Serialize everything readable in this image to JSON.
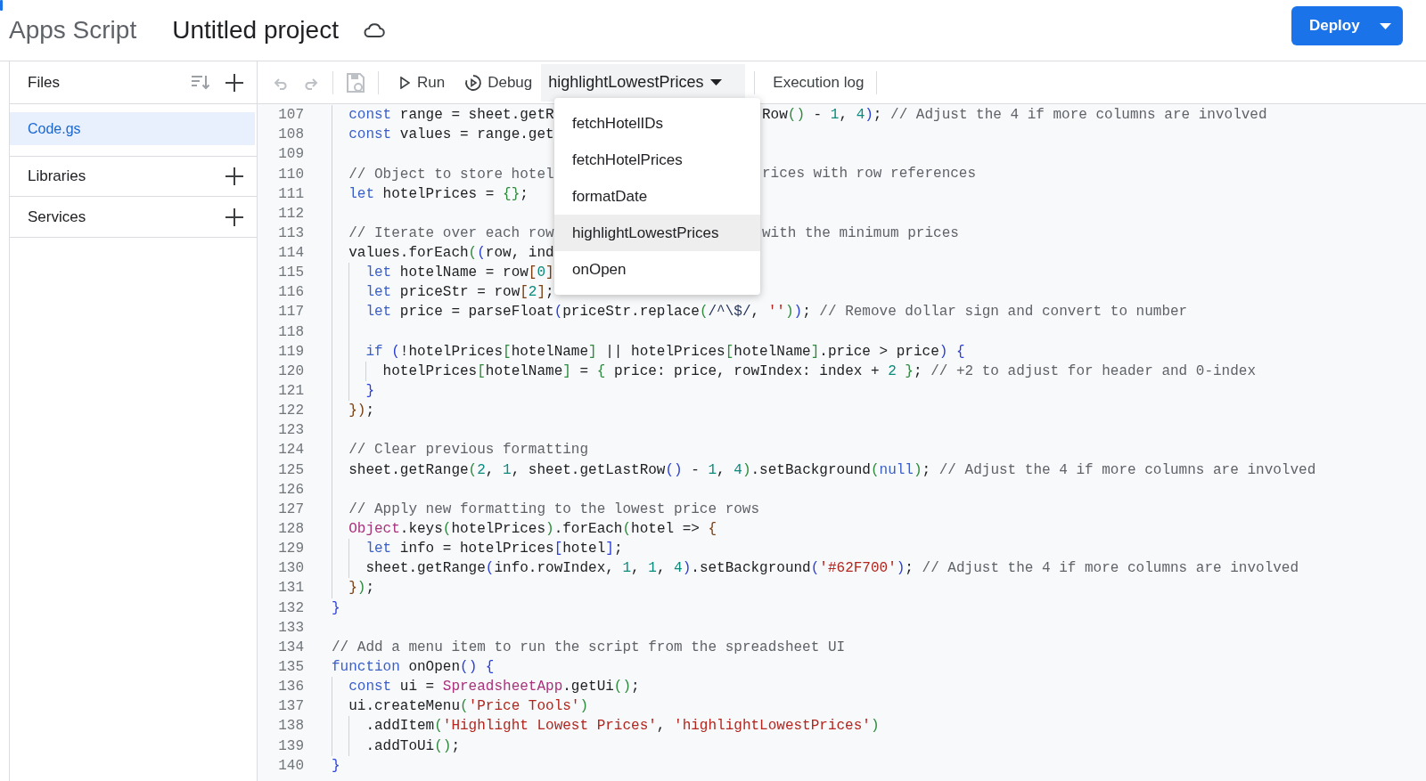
{
  "app": {
    "name": "Apps Script",
    "project_title": "Untitled project",
    "deploy_label": "Deploy"
  },
  "sidebar": {
    "files_label": "Files",
    "files": [
      {
        "name": "Code.gs",
        "selected": true
      }
    ],
    "sections": [
      {
        "label": "Libraries"
      },
      {
        "label": "Services"
      }
    ]
  },
  "toolbar": {
    "run_label": "Run",
    "debug_label": "Debug",
    "function_label": "highlightLowestPrices",
    "execution_log_label": "Execution log"
  },
  "function_menu": {
    "items": [
      {
        "label": "fetchHotelIDs",
        "selected": false
      },
      {
        "label": "fetchHotelPrices",
        "selected": false
      },
      {
        "label": "formatDate",
        "selected": false
      },
      {
        "label": "highlightLowestPrices",
        "selected": true
      },
      {
        "label": "onOpen",
        "selected": false
      }
    ]
  },
  "editor": {
    "lines": [
      {
        "number": "107",
        "parts": [
          {
            "kind": "kw",
            "text": "  const"
          },
          {
            "kind": "p",
            "text": " range = sheet.getR"
          }
        ],
        "after_menu": [
          {
            "kind": "p",
            "text": "Row"
          },
          {
            "kind": "b2",
            "text": "()"
          },
          {
            "kind": "p",
            "text": " - "
          },
          {
            "kind": "num",
            "text": "1"
          },
          {
            "kind": "p",
            "text": ", "
          },
          {
            "kind": "num",
            "text": "4"
          },
          {
            "kind": "b1",
            "text": ")"
          },
          {
            "kind": "p",
            "text": "; "
          },
          {
            "kind": "cm",
            "text": "// Adjust the 4 if more columns are involved"
          }
        ]
      },
      {
        "number": "108",
        "parts": [
          {
            "kind": "kw",
            "text": "  const"
          },
          {
            "kind": "p",
            "text": " values = range.get"
          }
        ]
      },
      {
        "number": "109"
      },
      {
        "number": "110",
        "parts": [
          {
            "kind": "cm",
            "text": "  // Object to store hotel"
          }
        ],
        "after_menu": [
          {
            "kind": "cm",
            "text": "rices with row references"
          }
        ]
      },
      {
        "number": "111",
        "parts": [
          {
            "kind": "kw",
            "text": "  let"
          },
          {
            "kind": "p",
            "text": " hotelPrices = "
          },
          {
            "kind": "b2",
            "text": "{}"
          },
          {
            "kind": "p",
            "text": ";"
          }
        ]
      },
      {
        "number": "112"
      },
      {
        "number": "113",
        "parts": [
          {
            "kind": "cm",
            "text": "  // Iterate over each row"
          }
        ],
        "after_menu": [
          {
            "kind": "cm",
            "text": "with the minimum prices"
          }
        ]
      },
      {
        "number": "114",
        "parts": [
          {
            "kind": "p",
            "text": "  values.forEach"
          },
          {
            "kind": "b2",
            "text": "("
          },
          {
            "kind": "b1",
            "text": "("
          },
          {
            "kind": "p",
            "text": "row, ind"
          }
        ]
      },
      {
        "number": "115",
        "parts": [
          {
            "kind": "kw",
            "text": "    let"
          },
          {
            "kind": "p",
            "text": " hotelName = row"
          },
          {
            "kind": "b3",
            "text": "["
          },
          {
            "kind": "num",
            "text": "0"
          },
          {
            "kind": "b3",
            "text": "]"
          }
        ]
      },
      {
        "number": "116",
        "parts": [
          {
            "kind": "kw",
            "text": "    let"
          },
          {
            "kind": "p",
            "text": " priceStr = row"
          },
          {
            "kind": "b3",
            "text": "["
          },
          {
            "kind": "num",
            "text": "2"
          },
          {
            "kind": "b3",
            "text": "]"
          },
          {
            "kind": "p",
            "text": ";"
          }
        ]
      },
      {
        "number": "117",
        "parts": [
          {
            "kind": "kw",
            "text": "    let"
          },
          {
            "kind": "p",
            "text": " price = parseFloat"
          },
          {
            "kind": "b1",
            "text": "("
          },
          {
            "kind": "p",
            "text": "priceStr.replace"
          },
          {
            "kind": "b2",
            "text": "("
          },
          {
            "kind": "re",
            "text": "/^\\$/"
          },
          {
            "kind": "p",
            "text": ", "
          },
          {
            "kind": "str",
            "text": "''"
          },
          {
            "kind": "b2",
            "text": ")"
          },
          {
            "kind": "b1",
            "text": ")"
          },
          {
            "kind": "p",
            "text": "; "
          },
          {
            "kind": "cm",
            "text": "// Remove dollar sign and convert to number"
          }
        ]
      },
      {
        "number": "118"
      },
      {
        "number": "119",
        "parts": [
          {
            "kind": "kw",
            "text": "    if"
          },
          {
            "kind": "b1",
            "text": " ("
          },
          {
            "kind": "p",
            "text": "!hotelPrices"
          },
          {
            "kind": "b2",
            "text": "["
          },
          {
            "kind": "p",
            "text": "hotelName"
          },
          {
            "kind": "b2",
            "text": "]"
          },
          {
            "kind": "p",
            "text": " || hotelPrices"
          },
          {
            "kind": "b2",
            "text": "["
          },
          {
            "kind": "p",
            "text": "hotelName"
          },
          {
            "kind": "b2",
            "text": "]"
          },
          {
            "kind": "p",
            "text": ".price > price"
          },
          {
            "kind": "b1",
            "text": ") {"
          }
        ]
      },
      {
        "number": "120",
        "parts": [
          {
            "kind": "p",
            "text": "      hotelPrices"
          },
          {
            "kind": "b2",
            "text": "["
          },
          {
            "kind": "p",
            "text": "hotelName"
          },
          {
            "kind": "b2",
            "text": "]"
          },
          {
            "kind": "p",
            "text": " = "
          },
          {
            "kind": "b2",
            "text": "{"
          },
          {
            "kind": "p",
            "text": " price: price, rowIndex: index + "
          },
          {
            "kind": "num",
            "text": "2"
          },
          {
            "kind": "b2",
            "text": " }"
          },
          {
            "kind": "p",
            "text": "; "
          },
          {
            "kind": "cm",
            "text": "// +2 to adjust for header and 0-index"
          }
        ]
      },
      {
        "number": "121",
        "parts": [
          {
            "kind": "b1",
            "text": "    }"
          }
        ]
      },
      {
        "number": "122",
        "parts": [
          {
            "kind": "b3",
            "text": "  })"
          },
          {
            "kind": "p",
            "text": ";"
          }
        ]
      },
      {
        "number": "123"
      },
      {
        "number": "124",
        "parts": [
          {
            "kind": "cm",
            "text": "  // Clear previous formatting"
          }
        ]
      },
      {
        "number": "125",
        "parts": [
          {
            "kind": "p",
            "text": "  sheet.getRange"
          },
          {
            "kind": "b2",
            "text": "("
          },
          {
            "kind": "num",
            "text": "2"
          },
          {
            "kind": "p",
            "text": ", "
          },
          {
            "kind": "num",
            "text": "1"
          },
          {
            "kind": "p",
            "text": ", sheet.getLastRow"
          },
          {
            "kind": "b1",
            "text": "()"
          },
          {
            "kind": "p",
            "text": " - "
          },
          {
            "kind": "num",
            "text": "1"
          },
          {
            "kind": "p",
            "text": ", "
          },
          {
            "kind": "num",
            "text": "4"
          },
          {
            "kind": "b2",
            "text": ")"
          },
          {
            "kind": "p",
            "text": ".setBackground"
          },
          {
            "kind": "b2",
            "text": "("
          },
          {
            "kind": "kw",
            "text": "null"
          },
          {
            "kind": "b2",
            "text": ")"
          },
          {
            "kind": "p",
            "text": "; "
          },
          {
            "kind": "cm",
            "text": "// Adjust the 4 if more columns are involved"
          }
        ]
      },
      {
        "number": "126"
      },
      {
        "number": "127",
        "parts": [
          {
            "kind": "cm",
            "text": "  // Apply new formatting to the lowest price rows"
          }
        ]
      },
      {
        "number": "128",
        "parts": [
          {
            "kind": "cls",
            "text": "  Object"
          },
          {
            "kind": "p",
            "text": ".keys"
          },
          {
            "kind": "b2",
            "text": "("
          },
          {
            "kind": "p",
            "text": "hotelPrices"
          },
          {
            "kind": "b2",
            "text": ")"
          },
          {
            "kind": "p",
            "text": ".forEach"
          },
          {
            "kind": "b2",
            "text": "("
          },
          {
            "kind": "p",
            "text": "hotel => "
          },
          {
            "kind": "b3",
            "text": "{"
          }
        ]
      },
      {
        "number": "129",
        "parts": [
          {
            "kind": "kw",
            "text": "    let"
          },
          {
            "kind": "p",
            "text": " info = hotelPrices"
          },
          {
            "kind": "b1",
            "text": "["
          },
          {
            "kind": "p",
            "text": "hotel"
          },
          {
            "kind": "b1",
            "text": "]"
          },
          {
            "kind": "p",
            "text": ";"
          }
        ]
      },
      {
        "number": "130",
        "parts": [
          {
            "kind": "p",
            "text": "    sheet.getRange"
          },
          {
            "kind": "b1",
            "text": "("
          },
          {
            "kind": "p",
            "text": "info.rowIndex, "
          },
          {
            "kind": "num",
            "text": "1"
          },
          {
            "kind": "p",
            "text": ", "
          },
          {
            "kind": "num",
            "text": "1"
          },
          {
            "kind": "p",
            "text": ", "
          },
          {
            "kind": "num",
            "text": "4"
          },
          {
            "kind": "b1",
            "text": ")"
          },
          {
            "kind": "p",
            "text": ".setBackground"
          },
          {
            "kind": "b1",
            "text": "("
          },
          {
            "kind": "str",
            "text": "'#62F700'"
          },
          {
            "kind": "b1",
            "text": ")"
          },
          {
            "kind": "p",
            "text": "; "
          },
          {
            "kind": "cm",
            "text": "// Adjust the 4 if more columns are involved"
          }
        ]
      },
      {
        "number": "131",
        "parts": [
          {
            "kind": "b3",
            "text": "  }"
          },
          {
            "kind": "b2",
            "text": ")"
          },
          {
            "kind": "p",
            "text": ";"
          }
        ]
      },
      {
        "number": "132",
        "parts": [
          {
            "kind": "b1",
            "text": "}"
          }
        ]
      },
      {
        "number": "133"
      },
      {
        "number": "134",
        "parts": [
          {
            "kind": "cm",
            "text": "// Add a menu item to run the script from the spreadsheet UI"
          }
        ]
      },
      {
        "number": "135",
        "parts": [
          {
            "kind": "kw",
            "text": "function"
          },
          {
            "kind": "p",
            "text": " onOpen"
          },
          {
            "kind": "b1",
            "text": "() {"
          }
        ]
      },
      {
        "number": "136",
        "parts": [
          {
            "kind": "kw",
            "text": "  const"
          },
          {
            "kind": "p",
            "text": " ui = "
          },
          {
            "kind": "cls",
            "text": "SpreadsheetApp"
          },
          {
            "kind": "p",
            "text": ".getUi"
          },
          {
            "kind": "b2",
            "text": "()"
          },
          {
            "kind": "p",
            "text": ";"
          }
        ]
      },
      {
        "number": "137",
        "parts": [
          {
            "kind": "p",
            "text": "  ui.createMenu"
          },
          {
            "kind": "b2",
            "text": "("
          },
          {
            "kind": "str",
            "text": "'Price Tools'"
          },
          {
            "kind": "b2",
            "text": ")"
          }
        ]
      },
      {
        "number": "138",
        "parts": [
          {
            "kind": "p",
            "text": "    .addItem"
          },
          {
            "kind": "b2",
            "text": "("
          },
          {
            "kind": "str",
            "text": "'Highlight Lowest Prices'"
          },
          {
            "kind": "p",
            "text": ", "
          },
          {
            "kind": "str",
            "text": "'highlightLowestPrices'"
          },
          {
            "kind": "b2",
            "text": ")"
          }
        ]
      },
      {
        "number": "139",
        "parts": [
          {
            "kind": "p",
            "text": "    .addToUi"
          },
          {
            "kind": "b2",
            "text": "()"
          },
          {
            "kind": "p",
            "text": ";"
          }
        ]
      },
      {
        "number": "140",
        "parts": [
          {
            "kind": "b1",
            "text": "}"
          }
        ]
      }
    ]
  }
}
